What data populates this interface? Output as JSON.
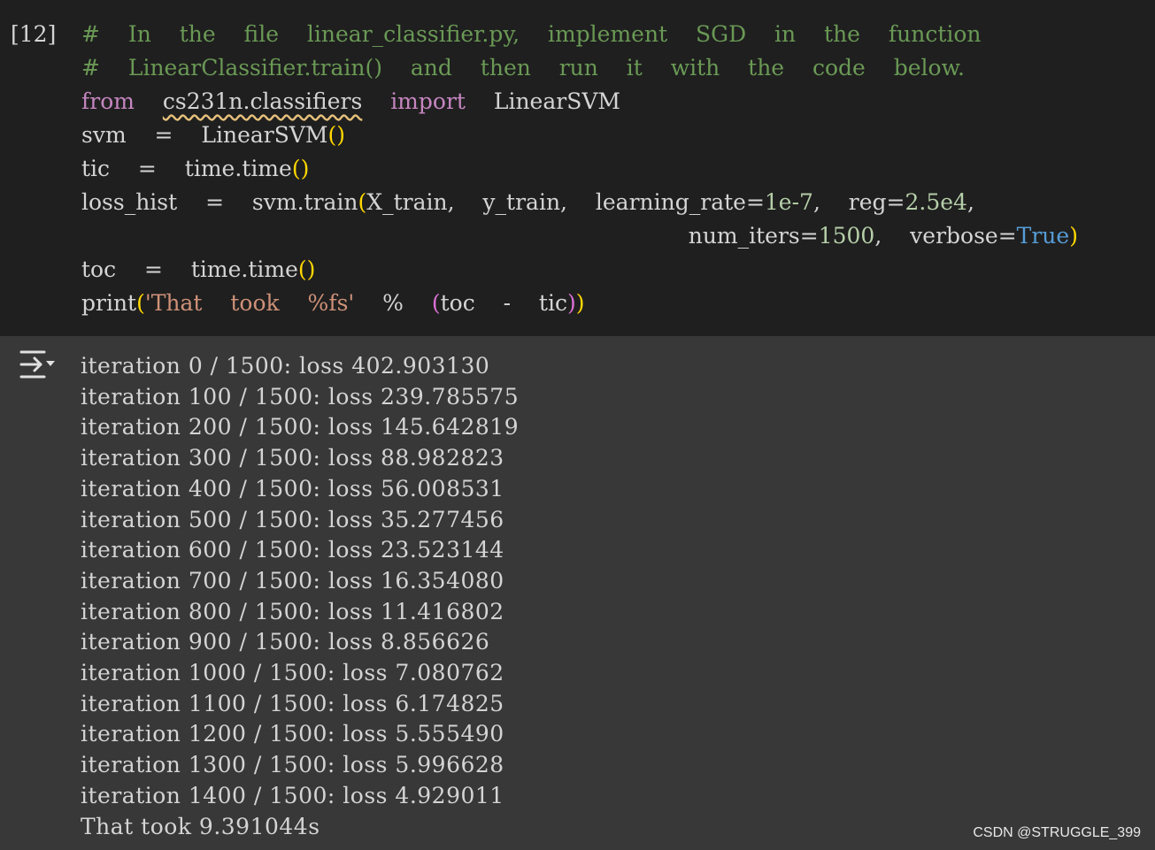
{
  "cell": {
    "execution_count": "[12]",
    "code_lines": [
      [
        {
          "t": "#  In  the  file  linear_classifier.py,  implement  SGD  in  the  function",
          "c": "comment"
        }
      ],
      [
        {
          "t": "#  LinearClassifier.train()  and  then  run  it  with  the  code  below.",
          "c": "comment"
        }
      ],
      [
        {
          "t": "from",
          "c": "keyword"
        },
        {
          "t": "  ",
          "c": "plain"
        },
        {
          "t": "cs231n.classifiers",
          "c": "plain",
          "squiggle": true
        },
        {
          "t": "  ",
          "c": "plain"
        },
        {
          "t": "import",
          "c": "keyword"
        },
        {
          "t": "  LinearSVM",
          "c": "plain"
        }
      ],
      [
        {
          "t": "svm  =  LinearSVM",
          "c": "plain"
        },
        {
          "t": "()",
          "c": "paren"
        }
      ],
      [
        {
          "t": "tic  =  time.time",
          "c": "plain"
        },
        {
          "t": "()",
          "c": "paren"
        }
      ],
      [
        {
          "t": "loss_hist  =  svm.train",
          "c": "plain"
        },
        {
          "t": "(",
          "c": "paren"
        },
        {
          "t": "X_train,  y_train,  learning_rate=",
          "c": "plain"
        },
        {
          "t": "1e-7",
          "c": "number"
        },
        {
          "t": ",  reg=",
          "c": "plain"
        },
        {
          "t": "2.5e4",
          "c": "number"
        },
        {
          "t": ",",
          "c": "plain"
        }
      ],
      [
        {
          "t": "                                           num_iters=",
          "c": "plain"
        },
        {
          "t": "1500",
          "c": "number"
        },
        {
          "t": ",  verbose=",
          "c": "plain"
        },
        {
          "t": "True",
          "c": "const"
        },
        {
          "t": ")",
          "c": "paren"
        }
      ],
      [
        {
          "t": "toc  =  time.time",
          "c": "plain"
        },
        {
          "t": "()",
          "c": "paren"
        }
      ],
      [
        {
          "t": "print",
          "c": "plain"
        },
        {
          "t": "(",
          "c": "paren"
        },
        {
          "t": "'That  took  %fs'",
          "c": "string"
        },
        {
          "t": "  %  ",
          "c": "plain"
        },
        {
          "t": "(",
          "c": "paren2"
        },
        {
          "t": "toc  -  tic",
          "c": "plain"
        },
        {
          "t": ")",
          "c": "paren2"
        },
        {
          "t": ")",
          "c": "paren"
        }
      ]
    ]
  },
  "output": {
    "icon": "output-toggle-icon",
    "lines": [
      "iteration 0 / 1500: loss 402.903130",
      "iteration 100 / 1500: loss 239.785575",
      "iteration 200 / 1500: loss 145.642819",
      "iteration 300 / 1500: loss 88.982823",
      "iteration 400 / 1500: loss 56.008531",
      "iteration 500 / 1500: loss 35.277456",
      "iteration 600 / 1500: loss 23.523144",
      "iteration 700 / 1500: loss 16.354080",
      "iteration 800 / 1500: loss 11.416802",
      "iteration 900 / 1500: loss 8.856626",
      "iteration 1000 / 1500: loss 7.080762",
      "iteration 1100 / 1500: loss 6.174825",
      "iteration 1200 / 1500: loss 5.555490",
      "iteration 1300 / 1500: loss 5.996628",
      "iteration 1400 / 1500: loss 4.929011",
      "That took 9.391044s"
    ]
  },
  "watermark": "CSDN @STRUGGLE_399"
}
